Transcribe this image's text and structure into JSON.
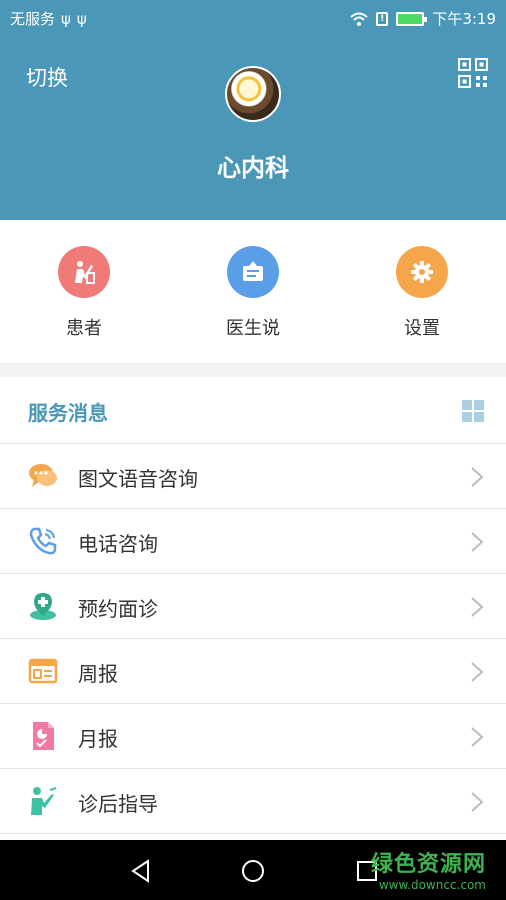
{
  "status_bar": {
    "carrier": "无服务",
    "usb1": "ψ",
    "usb2": "ψ",
    "alert": "!",
    "time": "下午3:19"
  },
  "header": {
    "switch_label": "切换",
    "department": "心内科"
  },
  "quick_actions": [
    {
      "label": "患者",
      "color": "#f07a78"
    },
    {
      "label": "医生说",
      "color": "#5b9ee8"
    },
    {
      "label": "设置",
      "color": "#f5a64a"
    }
  ],
  "services": {
    "title": "服务消息",
    "items": [
      {
        "label": "图文语音咨询",
        "icon": "chat-bubbles-icon",
        "color": "#f5a64a"
      },
      {
        "label": "电话咨询",
        "icon": "phone-icon",
        "color": "#5b9ee8"
      },
      {
        "label": "预约面诊",
        "icon": "location-pin-icon",
        "color": "#3ec2a3"
      },
      {
        "label": "周报",
        "icon": "weekly-report-icon",
        "color": "#f5a64a"
      },
      {
        "label": "月报",
        "icon": "monthly-report-icon",
        "color": "#f07aa0"
      },
      {
        "label": "诊后指导",
        "icon": "teacher-icon",
        "color": "#3ec2a3"
      }
    ]
  },
  "watermark": {
    "title": "绿色资源网",
    "url": "www.downcc.com"
  }
}
